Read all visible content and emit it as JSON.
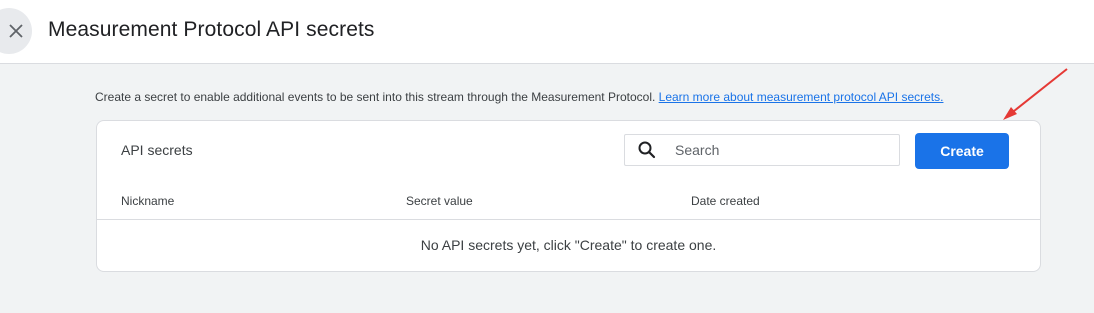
{
  "header": {
    "title": "Measurement Protocol API secrets",
    "close_icon": "close-icon"
  },
  "description": {
    "text": "Create a secret to enable additional events to be sent into this stream through the Measurement Protocol. ",
    "link": "Learn more about measurement protocol API secrets."
  },
  "card": {
    "title": "API secrets",
    "search": {
      "placeholder": "Search",
      "value": "",
      "icon": "search-icon"
    },
    "create_label": "Create",
    "columns": [
      "Nickname",
      "Secret value",
      "Date created"
    ],
    "empty_message": "No API secrets yet, click \"Create\" to create one."
  },
  "colors": {
    "accent": "#1a73e8",
    "annotation_arrow": "#e53935",
    "background": "#f1f3f4"
  }
}
